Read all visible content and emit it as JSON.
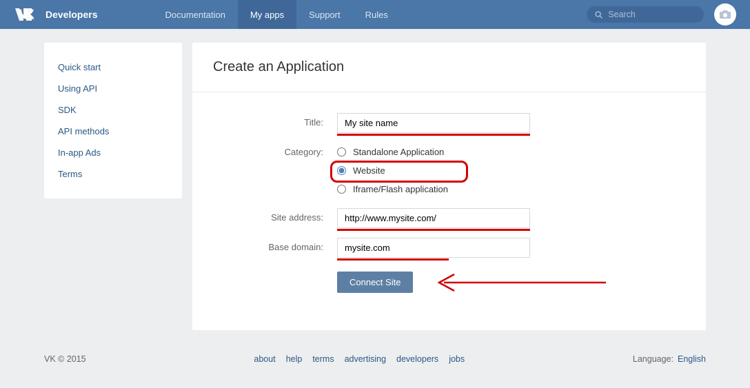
{
  "header": {
    "brand": "Developers",
    "nav": {
      "documentation": "Documentation",
      "my_apps": "My apps",
      "support": "Support",
      "rules": "Rules"
    },
    "search_placeholder": "Search"
  },
  "sidebar": {
    "items": {
      "quick_start": "Quick start",
      "using_api": "Using API",
      "sdk": "SDK",
      "api_methods": "API methods",
      "in_app_ads": "In-app Ads",
      "terms": "Terms"
    }
  },
  "main": {
    "title": "Create an Application",
    "labels": {
      "title": "Title:",
      "category": "Category:",
      "site_address": "Site address:",
      "base_domain": "Base domain:"
    },
    "values": {
      "title": "My site name",
      "site_address": "http://www.mysite.com/",
      "base_domain": "mysite.com"
    },
    "radios": {
      "standalone": "Standalone Application",
      "website": "Website",
      "iframe": "Iframe/Flash application"
    },
    "submit": "Connect Site"
  },
  "footer": {
    "copyright": "VK © 2015",
    "links": {
      "about": "about",
      "help": "help",
      "terms": "terms",
      "advertising": "advertising",
      "developers": "developers",
      "jobs": "jobs"
    },
    "lang_label": "Language:",
    "lang_value": "English"
  }
}
